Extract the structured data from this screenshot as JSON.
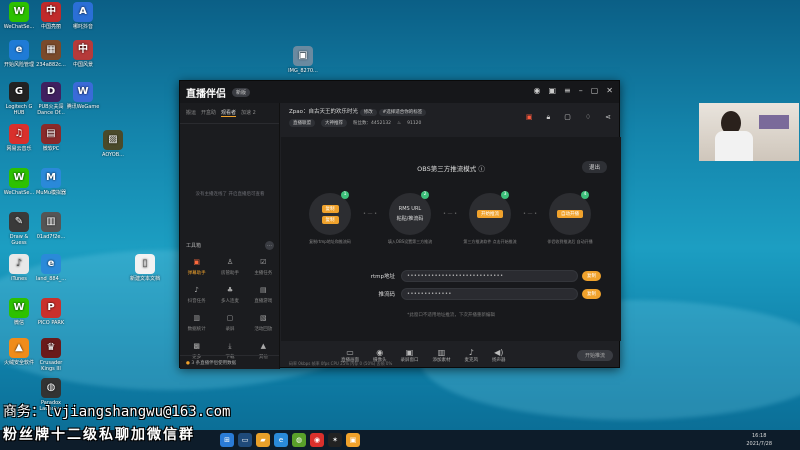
{
  "desktop": {
    "icons": [
      {
        "label": "WeChatSe...",
        "color": "#2dc100",
        "glyph": "W"
      },
      {
        "label": "中国亮丽",
        "color": "#c02a2a",
        "glyph": "中"
      },
      {
        "label": "哪吒抖音",
        "color": "#2b6fd6",
        "glyph": "A"
      },
      {
        "label": "开始风险管理",
        "color": "#1f7bd6",
        "glyph": "e"
      },
      {
        "label": "234a882c...",
        "color": "#7a4a2a",
        "glyph": "▦"
      },
      {
        "label": "中国风景",
        "color": "#b63a3a",
        "glyph": "中"
      },
      {
        "label": "Logitech G HUB",
        "color": "#222",
        "glyph": "G"
      },
      {
        "label": "PUB火夫闯 Dance Of...",
        "color": "#402060",
        "glyph": "D"
      },
      {
        "label": "腾讯WeGame",
        "color": "#3a6bd8",
        "glyph": "W"
      },
      {
        "label": "网易云音乐",
        "color": "#d9302c",
        "glyph": "♫"
      },
      {
        "label": "微软PC",
        "color": "#8a2a2a",
        "glyph": "▤"
      },
      {
        "label": "WeChatSe...",
        "color": "#2dc100",
        "glyph": "W"
      },
      {
        "label": "MuMu模拟器",
        "color": "#2a89d9",
        "glyph": "M"
      },
      {
        "label": "Draw & Guess",
        "color": "#3a3a3a",
        "glyph": "✎"
      },
      {
        "label": "01ad7f2e...",
        "color": "#555",
        "glyph": "▥"
      },
      {
        "label": "iTunes",
        "color": "#e8e8e8",
        "glyph": "♪"
      },
      {
        "label": "land_884_...",
        "color": "#2a8ad9",
        "glyph": "e"
      },
      {
        "label": "微信",
        "color": "#2dc100",
        "glyph": "W"
      },
      {
        "label": "PICO PARK",
        "color": "#c9302c",
        "glyph": "P"
      },
      {
        "label": "火绒安全软件",
        "color": "#f08c1a",
        "glyph": "▲"
      },
      {
        "label": "Crusader Kings III",
        "color": "#6a1a1a",
        "glyph": "♛"
      },
      {
        "label": "Paradox Launcher",
        "color": "#333",
        "glyph": "◍"
      },
      {
        "label": "AOYOB...",
        "color": "#4a4a2a",
        "glyph": "▨"
      },
      {
        "label": "IMG_8270...",
        "color": "#6a8aa0",
        "glyph": "▣"
      },
      {
        "label": "新建文本文档",
        "color": "#f2f2f2",
        "glyph": "▯"
      }
    ]
  },
  "app": {
    "logo": "直播伴侣",
    "version": "新版",
    "tabs": [
      "搬运",
      "开盒助",
      "观看者",
      "加速 2"
    ],
    "active_tab_index": 2,
    "empty_text": "没有主播连线了 开启直播后可查看",
    "tools_title": "工具箱",
    "tools": [
      {
        "label": "弹幕助手",
        "glyph": "▣",
        "hl": true
      },
      {
        "label": "房管助手",
        "glyph": "♙",
        "hl": false
      },
      {
        "label": "主播任务",
        "glyph": "☑",
        "hl": false
      },
      {
        "label": "抖音任务",
        "glyph": "♪",
        "hl": false
      },
      {
        "label": "多人连麦",
        "glyph": "♣",
        "hl": false
      },
      {
        "label": "直播游戏",
        "glyph": "▤",
        "hl": false
      },
      {
        "label": "数据统计",
        "glyph": "▥",
        "hl": false
      },
      {
        "label": "录屏",
        "glyph": "▢",
        "hl": false
      },
      {
        "label": "活动回放",
        "glyph": "▧",
        "hl": false
      },
      {
        "label": "更多",
        "glyph": "▩",
        "hl": false
      },
      {
        "label": "下载",
        "glyph": "⤓",
        "hl": false
      },
      {
        "label": "其他",
        "glyph": "▲",
        "hl": false
      }
    ],
    "left_footer": "3 条直播伴侣使用数据",
    "stream_title": "Zpao：自古天王的欢乐时光",
    "tag_edit": "修改",
    "tag2": "#选择适合你的标签",
    "tag3": "直播联盟",
    "tag4": "大神推荐",
    "fans": "粉丝数：4452132",
    "likes": "91120",
    "mode_title": "OBS第三方推流模式",
    "exit_label": "退出",
    "steps": [
      {
        "num": "1",
        "buttons": [
          "复制",
          "复制"
        ],
        "desc": "复制rtmp地址和推流码"
      },
      {
        "num": "2",
        "buttons": [
          "RMS URL",
          "粘贴/推流码"
        ],
        "desc": "填入OBS设置第三方推流"
      },
      {
        "num": "3",
        "buttons": [
          "开始推流"
        ],
        "desc": "第三方推流软件 点击开始推流"
      },
      {
        "num": "4",
        "buttons": [
          "自动开播"
        ],
        "desc": "伴侣收到推流后 自动开播"
      }
    ],
    "rtmp_label": "rtmp地址",
    "rtmp_value": "••••••••••••••••••••••••••••",
    "key_label": "推流码",
    "key_value": "•••••••••••••",
    "copy_label": "复制",
    "hint": "*此窗口不适用地址推流，下次开播重新编辑",
    "toolbar": [
      {
        "label": "直播画面",
        "glyph": "▭"
      },
      {
        "label": "摄像头",
        "glyph": "◉"
      },
      {
        "label": "录屏窗口",
        "glyph": "▣"
      },
      {
        "label": "添加素材",
        "glyph": "▥"
      },
      {
        "label": "麦克风",
        "glyph": "♪"
      },
      {
        "label": "扬声器",
        "glyph": "◀)"
      }
    ],
    "start_label": "开始推流",
    "status": "码率 0kbps  帧率 0fps  CPU 25%  内存 0 (50%)  丢帧 0%"
  },
  "clock": {
    "time": "16:18",
    "date": "2021/7/28"
  },
  "overlay": {
    "line1": "商务：lvjiangshangwu@163.com",
    "line2": "粉丝牌十二级私聊加微信群"
  },
  "colors": {
    "accent": "#f0a22c",
    "green": "#3dbf7a",
    "danger": "#ff5a3d"
  }
}
